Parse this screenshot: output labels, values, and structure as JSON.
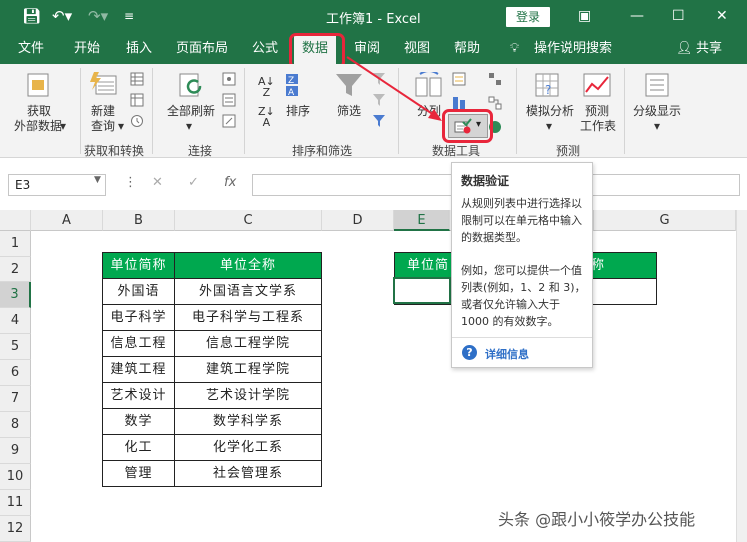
{
  "title_bar": {
    "title": "工作簿1 - Excel",
    "login": "登录",
    "qa_save": "save-icon",
    "qa_undo": "undo-icon",
    "qa_redo": "redo-icon",
    "qa_custom": "customize-icon",
    "win_restore": "restore-icon",
    "win_min": "minimize-icon",
    "win_max": "maximize-icon",
    "win_close": "close-icon"
  },
  "tabs": [
    "文件",
    "开始",
    "插入",
    "页面布局",
    "公式",
    "数据",
    "审阅",
    "视图",
    "帮助"
  ],
  "tell_me": "操作说明搜索",
  "share": "共享",
  "ribbon": {
    "get_data": "获取",
    "get_data2": "外部数据",
    "new_query": "新建",
    "new_query2": "查询",
    "refresh_all": "全部刷新",
    "sort": "排序",
    "filter": "筛选",
    "text_to_col": "分列",
    "what_if": "模拟分析",
    "forecast": "预测",
    "forecast2": "工作表",
    "outline": "分级显示",
    "groups": [
      "获取和转换",
      "连接",
      "排序和筛选",
      "数据工具",
      "预测"
    ]
  },
  "formula_bar": {
    "name_box": "E3",
    "fx": "fx",
    "cancel": "✕",
    "confirm": "✓"
  },
  "columns": [
    "A",
    "B",
    "C",
    "D",
    "E",
    "G"
  ],
  "rows": [
    "1",
    "2",
    "3",
    "4",
    "5",
    "6",
    "7",
    "8",
    "9",
    "10",
    "11",
    "12"
  ],
  "table": {
    "headers": [
      "单位简称",
      "单位全称"
    ],
    "rows": [
      [
        "外国语",
        "外国语言文学系"
      ],
      [
        "电子科学",
        "电子科学与工程系"
      ],
      [
        "信息工程",
        "信息工程学院"
      ],
      [
        "建筑工程",
        "建筑工程学院"
      ],
      [
        "艺术设计",
        "艺术设计学院"
      ],
      [
        "数学",
        "数学科学系"
      ],
      [
        "化工",
        "化学化工系"
      ],
      [
        "管理",
        "社会管理系"
      ]
    ]
  },
  "e_table": {
    "header_left": "单位简",
    "header_right": "称"
  },
  "tooltip": {
    "title": "数据验证",
    "body1": "从规则列表中进行选择以限制可以在单元格中输入的数据类型。",
    "body2": "例如，您可以提供一个值列表(例如，1、2 和 3)，或者仅允许输入大于 1000 的有效数字。",
    "more": "详细信息"
  },
  "watermark": "头条 @跟小小筱学办公技能",
  "colors": {
    "accent": "#217346",
    "table_header": "#00a84f",
    "highlight": "#e8263b"
  }
}
